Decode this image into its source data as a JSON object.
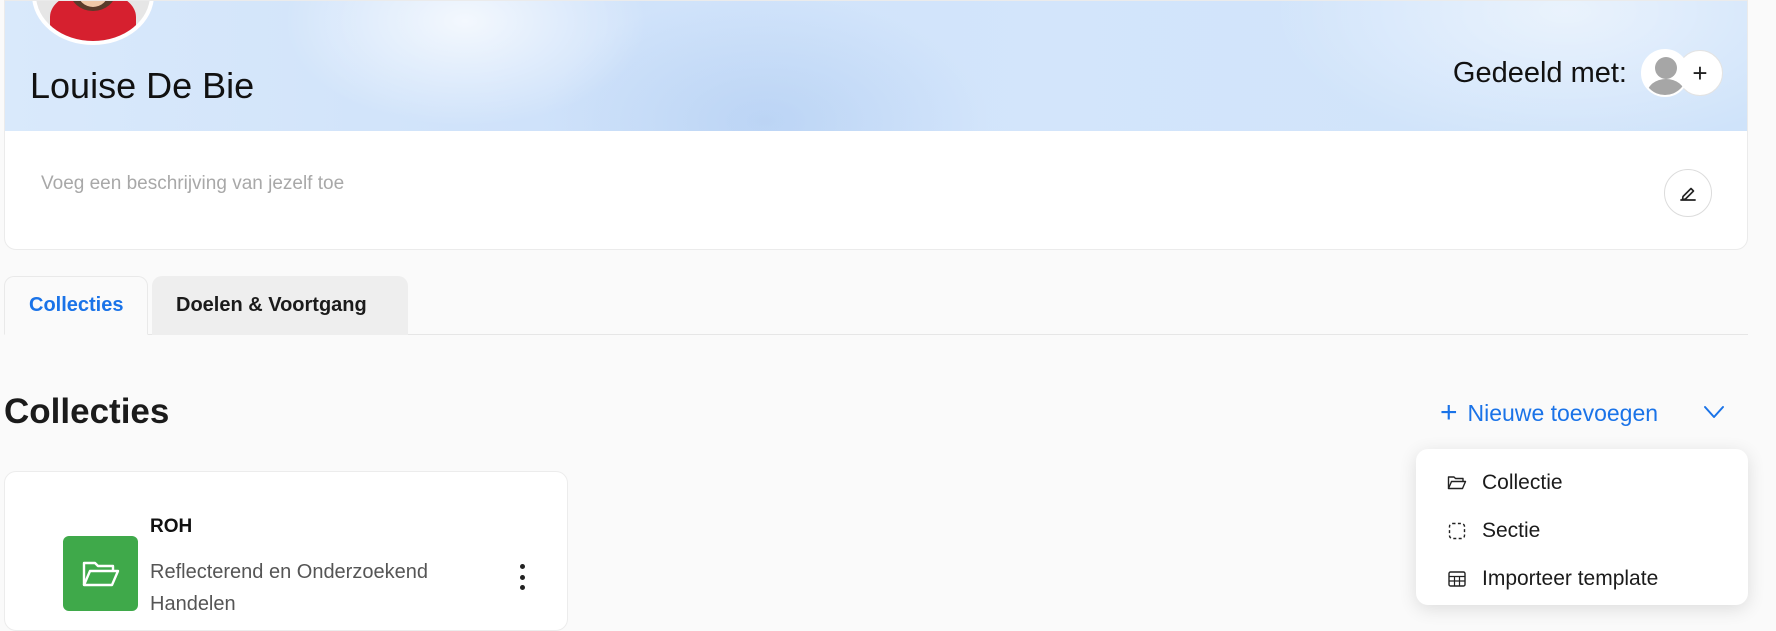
{
  "profile": {
    "name": "Louise De Bie",
    "shared_label": "Gedeeld met:",
    "add_share_symbol": "+",
    "description_placeholder": "Voeg een beschrijving van jezelf toe"
  },
  "tabs": [
    {
      "label": "Collecties",
      "active": true
    },
    {
      "label": "Doelen & Voortgang",
      "active": false
    }
  ],
  "collections_section": {
    "title": "Collecties",
    "add_new_label": "Nieuwe toevoegen",
    "add_new_symbol": "+"
  },
  "collections": [
    {
      "title": "ROH",
      "description": "Reflecterend en Onderzoekend Handelen",
      "icon": "folder-open-icon",
      "color": "#3fa94a"
    }
  ],
  "add_menu": {
    "items": [
      {
        "label": "Collectie",
        "icon": "folder-icon"
      },
      {
        "label": "Sectie",
        "icon": "dashed-square-icon"
      },
      {
        "label": "Importeer template",
        "icon": "template-icon"
      }
    ]
  },
  "colors": {
    "accent": "#1a73e8",
    "folder": "#3fa94a"
  }
}
